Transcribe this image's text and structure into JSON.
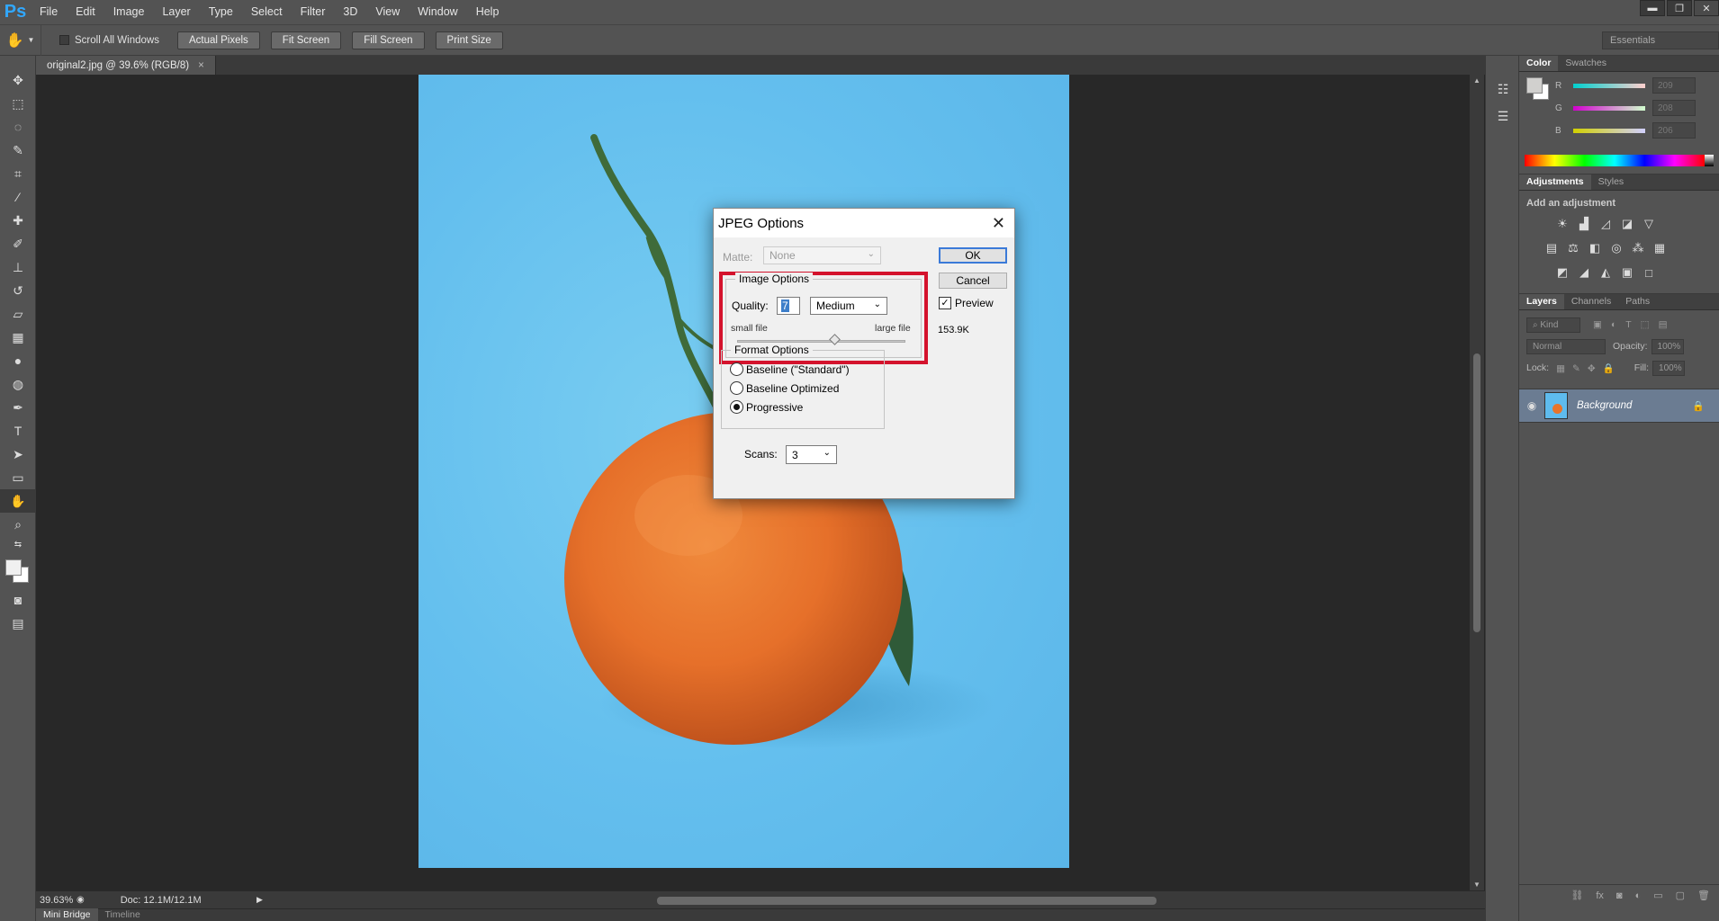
{
  "app": {
    "logo": "Ps"
  },
  "menu": [
    "File",
    "Edit",
    "Image",
    "Layer",
    "Type",
    "Select",
    "Filter",
    "3D",
    "View",
    "Window",
    "Help"
  ],
  "window_controls": {
    "minimize": "▬",
    "restore": "❐",
    "close": "✕"
  },
  "options_bar": {
    "tool_icon": "hand-icon",
    "scroll_all_windows": "Scroll All Windows",
    "buttons": [
      "Actual Pixels",
      "Fit Screen",
      "Fill Screen",
      "Print Size"
    ],
    "workspace": "Essentials"
  },
  "tools": [
    "move",
    "marquee",
    "lasso",
    "quick-select",
    "crop",
    "eyedropper",
    "healing",
    "brush",
    "stamp",
    "history-brush",
    "eraser",
    "gradient",
    "blur",
    "dodge",
    "pen",
    "type",
    "path-select",
    "shape",
    "hand",
    "zoom"
  ],
  "document": {
    "tab_title": "original2.jpg @ 39.6% (RGB/8)",
    "tab_close": "×"
  },
  "status": {
    "zoom": "39.63%",
    "doc": "Doc: 12.1M/12.1M"
  },
  "bottom_tabs": [
    "Mini Bridge",
    "Timeline"
  ],
  "color_panel": {
    "tabs": [
      "Color",
      "Swatches"
    ],
    "channels": [
      {
        "label": "R",
        "value": "209"
      },
      {
        "label": "G",
        "value": "208"
      },
      {
        "label": "B",
        "value": "206"
      }
    ],
    "foreground": "#d1d0ce"
  },
  "adjustments_panel": {
    "tabs": [
      "Adjustments",
      "Styles"
    ],
    "title": "Add an adjustment"
  },
  "layers_panel": {
    "tabs": [
      "Layers",
      "Channels",
      "Paths"
    ],
    "kind": "Kind",
    "blend_mode": "Normal",
    "opacity_label": "Opacity:",
    "opacity_value": "100%",
    "lock_label": "Lock:",
    "fill_label": "Fill:",
    "fill_value": "100%",
    "layers": [
      {
        "name": "Background",
        "visible": true,
        "locked": true
      }
    ]
  },
  "jpeg_dialog": {
    "title": "JPEG Options",
    "matte_label": "Matte:",
    "matte_value": "None",
    "image_options_title": "Image Options",
    "quality_label": "Quality:",
    "quality_value": "7",
    "quality_preset": "Medium",
    "small_file": "small file",
    "large_file": "large file",
    "quality_slider": {
      "min": 0,
      "max": 12,
      "value": 7
    },
    "format_options_title": "Format Options",
    "formats": [
      {
        "label": "Baseline (\"Standard\")",
        "selected": false
      },
      {
        "label": "Baseline Optimized",
        "selected": false
      },
      {
        "label": "Progressive",
        "selected": true
      }
    ],
    "scans_label": "Scans:",
    "scans_value": "3",
    "ok": "OK",
    "cancel": "Cancel",
    "preview_label": "Preview",
    "preview_checked": true,
    "file_size": "153.9K"
  },
  "colors": {
    "highlight_border": "#d4132d",
    "canvas_blue": "#64bfee",
    "orange": "#e8742a"
  }
}
